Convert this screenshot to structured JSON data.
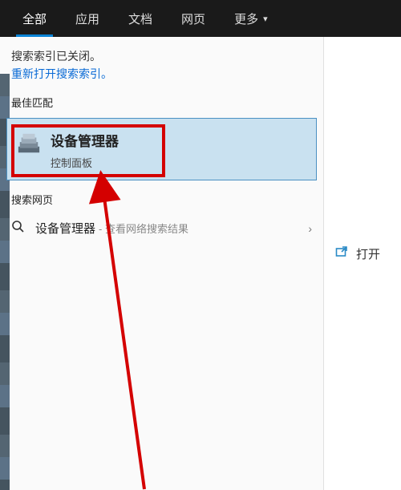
{
  "tabs": {
    "all": "全部",
    "apps": "应用",
    "docs": "文档",
    "web": "网页",
    "more": "更多"
  },
  "notice": {
    "line1": "搜索索引已关闭。",
    "link": "重新打开搜索索引。"
  },
  "sections": {
    "best_match": "最佳匹配",
    "search_web": "搜索网页"
  },
  "best_result": {
    "title": "设备管理器",
    "subtitle": "控制面板"
  },
  "web_result": {
    "query": "设备管理器",
    "hint": " - 查看网络搜索结果"
  },
  "right_panel": {
    "open": "打开"
  }
}
